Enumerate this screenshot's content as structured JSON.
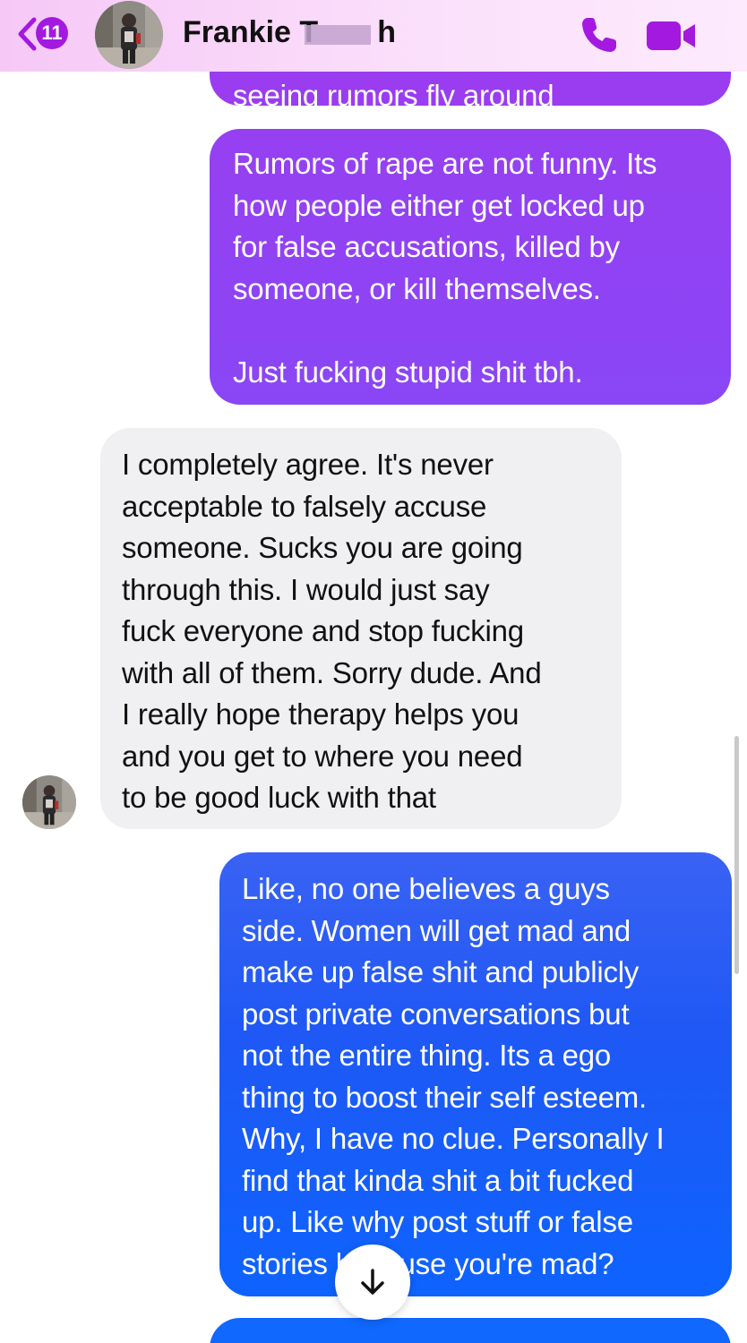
{
  "header": {
    "back_badge_count": "11",
    "contact_name": "Frankie T       h",
    "call_icon": "phone-icon",
    "video_icon": "video-camera-icon",
    "back_icon": "chevron-left-icon",
    "accent_color": "#a419e0"
  },
  "messages": [
    {
      "direction": "sent",
      "partial": true,
      "text": "seeing rumors fly around"
    },
    {
      "direction": "sent",
      "text": "Rumors of rape are not funny. Its\nhow people either get locked up\nfor false accusations, killed by\nsomeone, or kill themselves.\n\nJust fucking stupid shit tbh."
    },
    {
      "direction": "received",
      "text": "I completely agree. It's never\nacceptable to falsely accuse\nsomeone. Sucks you are going\nthrough this. I would just say\nfuck everyone and stop fucking\nwith all of them. Sorry dude. And\nI really hope therapy helps you\nand you get to where you need\nto be good luck with that"
    },
    {
      "direction": "sent",
      "text": "Like, no one believes a guys\nside. Women will get mad and\nmake up false shit and publicly\npost private conversations but\nnot the entire thing. Its a ego\nthing to boost their self esteem.\nWhy, I have no clue. Personally I\nfind that kinda shit a bit fucked\nup. Like why post stuff or false\nstories because you're mad?"
    }
  ],
  "scroll_down_icon": "arrow-down-icon",
  "colors": {
    "sent_purple": "#8f43f3",
    "sent_blue": "#1a5cf6",
    "received_bg": "#f0f0f3"
  }
}
